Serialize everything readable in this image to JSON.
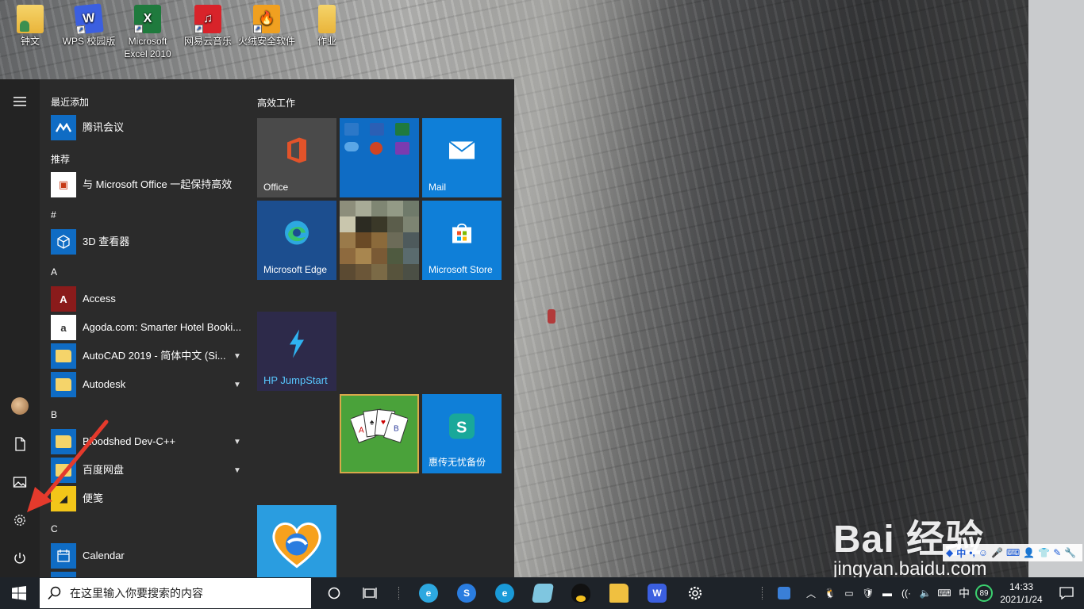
{
  "desktop": {
    "icons": [
      {
        "label": "钟文",
        "icon": "user-folder-icon"
      },
      {
        "label": "WPS 校园版",
        "icon": "wps-icon"
      },
      {
        "label": "Microsoft Excel 2010",
        "icon": "excel-icon"
      },
      {
        "label": "网易云音乐",
        "icon": "netease-music-icon"
      },
      {
        "label": "火绒安全软件",
        "icon": "huorong-icon"
      },
      {
        "label": "作业",
        "icon": "folder-icon"
      }
    ]
  },
  "start_menu": {
    "rail": [
      "hamburger-icon",
      "avatar",
      "document-icon",
      "pictures-icon",
      "settings-icon",
      "power-icon"
    ],
    "app_list": {
      "recent_header": "最近添加",
      "recommend_header": "推荐",
      "hash_header": "#",
      "a_header": "A",
      "b_header": "B",
      "c_header": "C",
      "apps": {
        "tencent_meeting": "腾讯会议",
        "office_promo": "与 Microsoft Office 一起保持高效",
        "viewer_3d": "3D 查看器",
        "access": "Access",
        "agoda": "Agoda.com: Smarter Hotel Booki...",
        "autocad": "AutoCAD 2019 - 简体中文 (Si...",
        "autodesk": "Autodesk",
        "bloodshed": "Bloodshed Dev-C++",
        "baidu_pan": "百度网盘",
        "sticky": "便笺",
        "calendar": "Calendar"
      }
    },
    "tiles": {
      "header": "高效工作",
      "office": "Office",
      "mail": "Mail",
      "edge": "Microsoft Edge",
      "store": "Microsoft Store",
      "hp": "HP JumpStart",
      "backup": "惠传无忧备份"
    }
  },
  "taskbar": {
    "search_placeholder": "在这里输入你要搜索的内容",
    "ime": "中",
    "battery": "89",
    "time": "14:33",
    "date": "2021/1/24"
  },
  "watermark": {
    "brand": "Bai 经验",
    "url": "jingyan.baidu.com"
  },
  "colors": {
    "accent_blue": "#0078d7",
    "menu_bg": "#2b2b2b",
    "taskbar_bg": "#1e2329",
    "annotation_arrow": "#e53a2c"
  }
}
